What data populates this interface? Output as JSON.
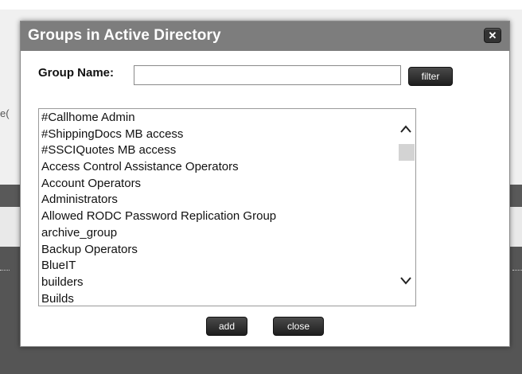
{
  "background": {
    "fragment": "e("
  },
  "dialog": {
    "title": "Groups in Active Directory",
    "close_glyph": "✕",
    "group_name_label": "Group Name:",
    "group_name_value": "",
    "filter_label": "filter",
    "add_label": "add",
    "close_label": "close",
    "groups": [
      "#Callhome Admin",
      "#ShippingDocs MB access",
      "#SSCIQuotes MB access",
      "Access Control Assistance Operators",
      "Account Operators",
      "Administrators",
      "Allowed RODC Password Replication Group",
      "archive_group",
      "Backup Operators",
      "BlueIT",
      "builders",
      "Builds"
    ]
  },
  "icons": {
    "scroll_up": "chevron-up-icon",
    "scroll_down": "chevron-down-icon",
    "dialog_close": "close-icon"
  },
  "colors": {
    "titlebar": "#7d7d7d",
    "button": "#2b2b2b",
    "overlay_dark": "#555555"
  }
}
